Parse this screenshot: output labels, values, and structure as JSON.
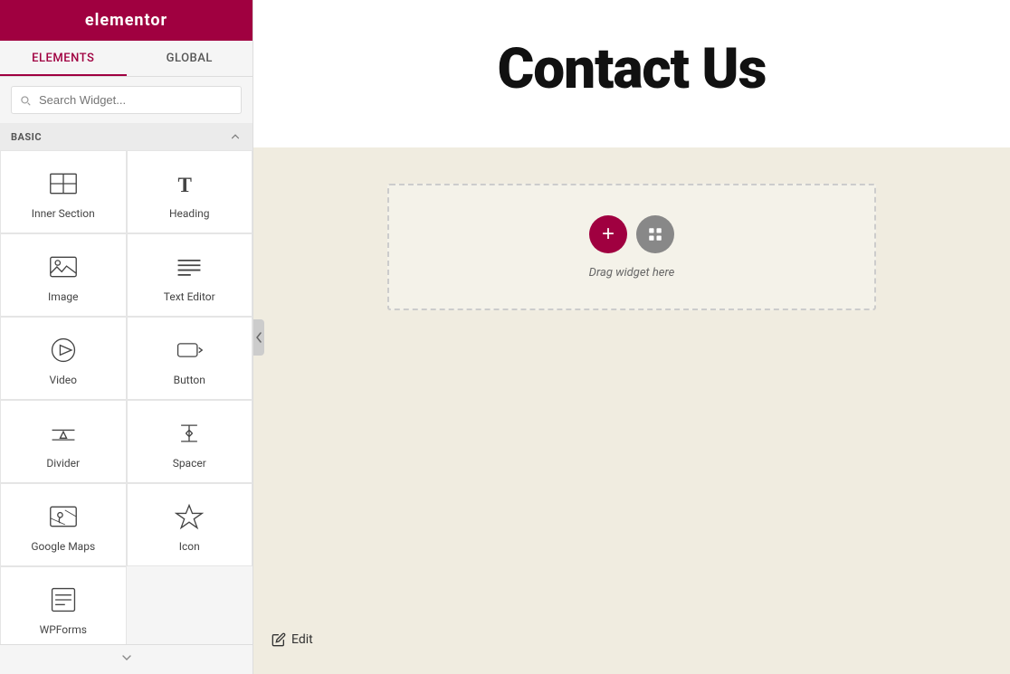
{
  "header": {
    "logo": "elementor",
    "hamburger_icon": "menu-icon",
    "grid_icon": "grid-icon"
  },
  "tabs": [
    {
      "label": "ELEMENTS",
      "active": true
    },
    {
      "label": "GLOBAL",
      "active": false
    }
  ],
  "search": {
    "placeholder": "Search Widget..."
  },
  "section": {
    "label": "BASIC"
  },
  "widgets": [
    {
      "id": "inner-section",
      "label": "Inner Section",
      "icon": "inner-section-icon"
    },
    {
      "id": "heading",
      "label": "Heading",
      "icon": "heading-icon"
    },
    {
      "id": "image",
      "label": "Image",
      "icon": "image-icon"
    },
    {
      "id": "text-editor",
      "label": "Text Editor",
      "icon": "text-editor-icon"
    },
    {
      "id": "video",
      "label": "Video",
      "icon": "video-icon"
    },
    {
      "id": "button",
      "label": "Button",
      "icon": "button-icon"
    },
    {
      "id": "divider",
      "label": "Divider",
      "icon": "divider-icon"
    },
    {
      "id": "spacer",
      "label": "Spacer",
      "icon": "spacer-icon"
    },
    {
      "id": "google-maps",
      "label": "Google Maps",
      "icon": "google-maps-icon"
    },
    {
      "id": "icon",
      "label": "Icon",
      "icon": "icon-icon"
    },
    {
      "id": "wpforms",
      "label": "WPForms",
      "icon": "wpforms-icon"
    }
  ],
  "canvas": {
    "page_title": "Contact Us",
    "drop_zone_label": "Drag widget here",
    "add_button_label": "+",
    "edit_label": "Edit"
  }
}
